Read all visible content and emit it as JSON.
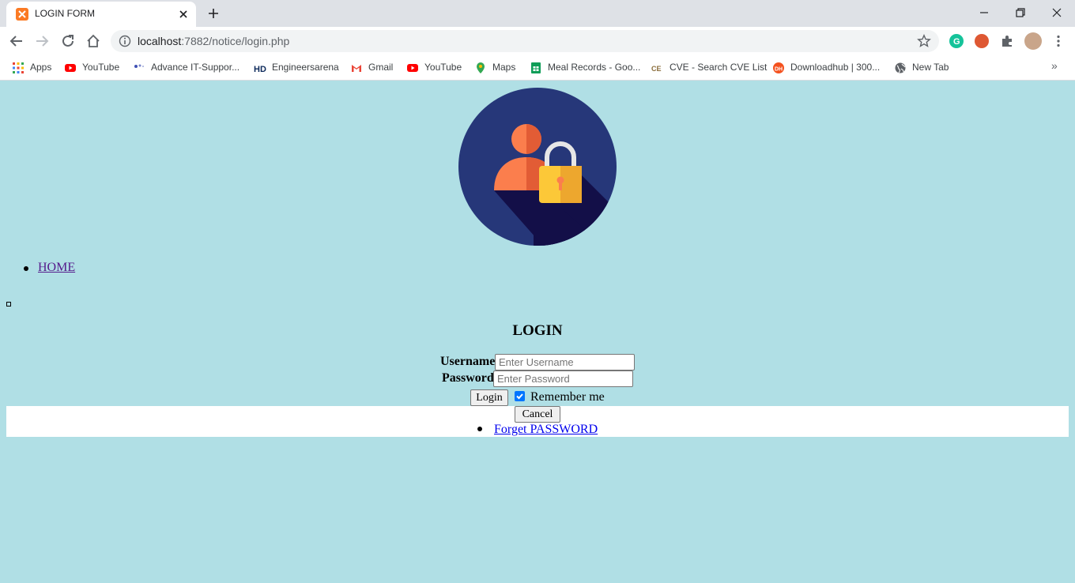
{
  "browser": {
    "tab_title": "LOGIN FORM",
    "url_host": "localhost",
    "url_path": ":7882/notice/login.php",
    "bookmarks": [
      {
        "label": "Apps",
        "icon": "apps-grid-icon"
      },
      {
        "label": "YouTube",
        "icon": "youtube-icon"
      },
      {
        "label": "Advance IT-Suppor...",
        "icon": "advance-it-icon"
      },
      {
        "label": "Engineersarena",
        "icon": "hd-icon"
      },
      {
        "label": "Gmail",
        "icon": "gmail-icon"
      },
      {
        "label": "YouTube",
        "icon": "youtube-icon"
      },
      {
        "label": "Maps",
        "icon": "maps-pin-icon"
      },
      {
        "label": "Meal Records - Goo...",
        "icon": "sheets-icon"
      },
      {
        "label": "CVE - Search CVE List",
        "icon": "cve-icon"
      },
      {
        "label": "Downloadhub | 300...",
        "icon": "downloadhub-icon"
      },
      {
        "label": "New Tab",
        "icon": "globe-icon"
      }
    ],
    "more_bookmarks": "»"
  },
  "page": {
    "nav": {
      "home": "HOME"
    },
    "login": {
      "title": "LOGIN",
      "username_label": "Username",
      "username_placeholder": "Enter Username",
      "password_label": "Password",
      "password_placeholder": "Enter Password",
      "login_button": "Login",
      "remember_label": "Remember me",
      "remember_checked": true,
      "cancel_button": "Cancel",
      "forget_link": "Forget PASSWORD"
    }
  }
}
